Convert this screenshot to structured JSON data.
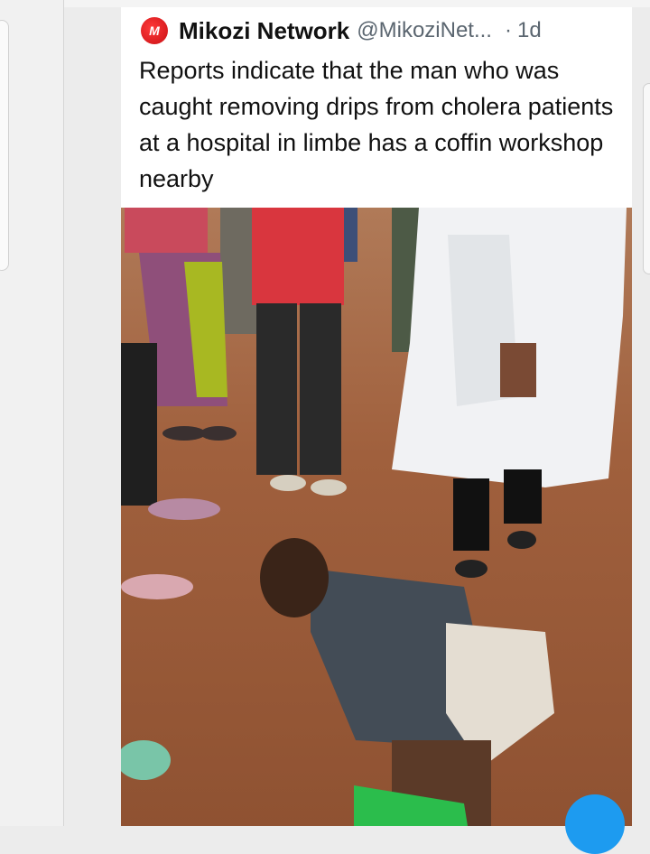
{
  "tweet": {
    "display_name": "Mikozi Network",
    "handle": "@MikoziNet...",
    "separator": "·",
    "time": "1d",
    "text": "Reports indicate that the man who was caught removing drips from cholera patients at a hospital in limbe has a coffin workshop nearby"
  },
  "avatar": {
    "icon": "mikozi-logo-icon",
    "glyph": "M"
  },
  "media": {
    "icon": "photo-crowd-man-on-ground"
  },
  "compose_button": {
    "icon": "compose-fab-icon"
  },
  "colors": {
    "accent": "#1d9bf0",
    "avatar_red": "#d8141a",
    "name": "#111111",
    "meta": "#5b6670"
  }
}
